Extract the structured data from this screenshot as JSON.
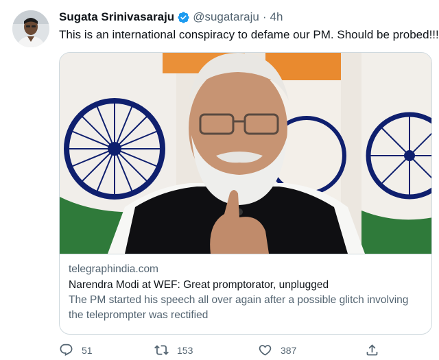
{
  "tweet": {
    "author_name": "Sugata Srinivasaraju",
    "handle": "@sugataraju",
    "separator": "·",
    "timestamp": "4h",
    "text": "This is an international conspiracy to defame our PM. Should be probed!!!"
  },
  "card": {
    "domain": "telegraphindia.com",
    "title": "Narendra Modi at WEF: Great promptorator, unplugged",
    "description": "The PM started his speech all over again after a possible glitch involving the teleprompter was rectified"
  },
  "actions": {
    "reply_count": "51",
    "retweet_count": "153",
    "like_count": "387"
  },
  "colors": {
    "text_primary": "#0f1419",
    "text_secondary": "#536471",
    "verified_blue": "#1d9bf0",
    "border": "#cfd9de"
  },
  "icons": {
    "verified": "verified-badge-icon",
    "reply": "reply-icon",
    "retweet": "retweet-icon",
    "like": "heart-icon",
    "share": "share-icon"
  }
}
